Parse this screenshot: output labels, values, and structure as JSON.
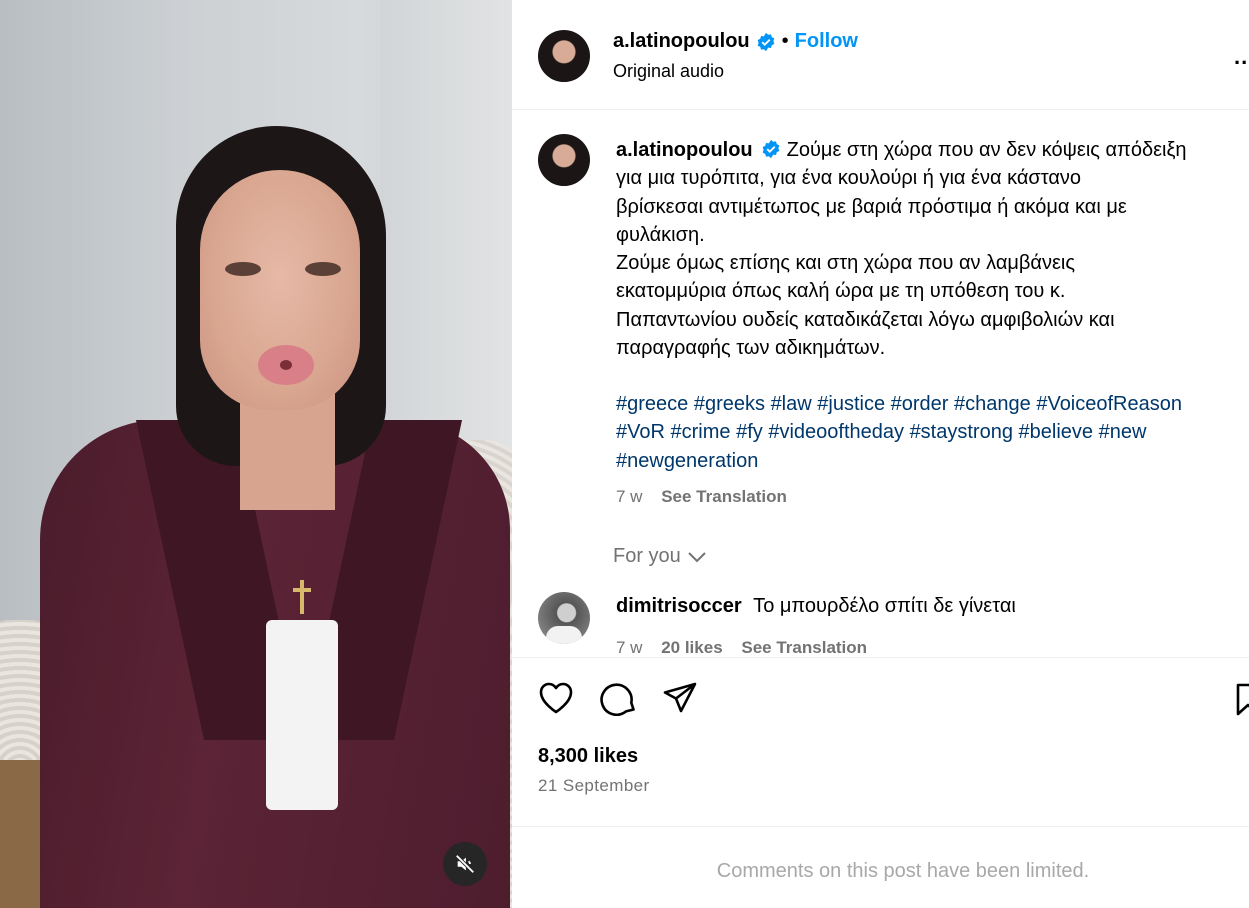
{
  "post": {
    "username": "a.latinopoulou",
    "follow_label": "Follow",
    "separator": "•",
    "audio": "Original audio",
    "more_label": "..."
  },
  "caption": {
    "lines": [
      "Ζούμε στη χώρα που αν δεν κόψεις απόδειξη",
      "για μια τυρόπιτα, για ένα κουλούρι ή για ένα κάστανο",
      "βρίσκεσαι αντιμέτωπος με βαριά πρόστιμα ή ακόμα και με",
      "φυλάκιση.",
      "Ζούμε όμως επίσης και στη χώρα που αν λαμβάνεις",
      "εκατομμύρια όπως καλή ώρα με τη υπόθεση του κ.",
      "Παπαντωνίου ουδείς καταδικάζεται λόγω αμφιβολιών και",
      "παραγραφής των αδικημάτων."
    ],
    "hashtags": [
      "#greece",
      "#greeks",
      "#law",
      "#justice",
      "#order",
      "#change",
      "#VoiceofReason",
      "#VoR",
      "#crime",
      "#fy",
      "#videooftheday",
      "#staystrong",
      "#believe",
      "#new",
      "#newgeneration"
    ],
    "time": "7 w",
    "see_translation": "See Translation"
  },
  "for_you": "For you",
  "comment": {
    "username": "dimitrisoccer",
    "text": "Το μπουρδέλο σπίτι δε γίνεται",
    "time": "7 w",
    "likes": "20 likes",
    "see_translation": "See Translation"
  },
  "stats": {
    "likes": "8,300 likes",
    "date": "21 September"
  },
  "limited_notice": "Comments on this post have been limited.",
  "icons": [
    "muted-speaker-icon",
    "verified-badge-icon",
    "heart-icon",
    "comment-icon",
    "share-icon",
    "bookmark-icon",
    "chevron-down-icon"
  ],
  "colors": {
    "link": "#0095f6",
    "hashtag": "#00376b",
    "secondary": "#737373",
    "verified": "#0095f6"
  }
}
